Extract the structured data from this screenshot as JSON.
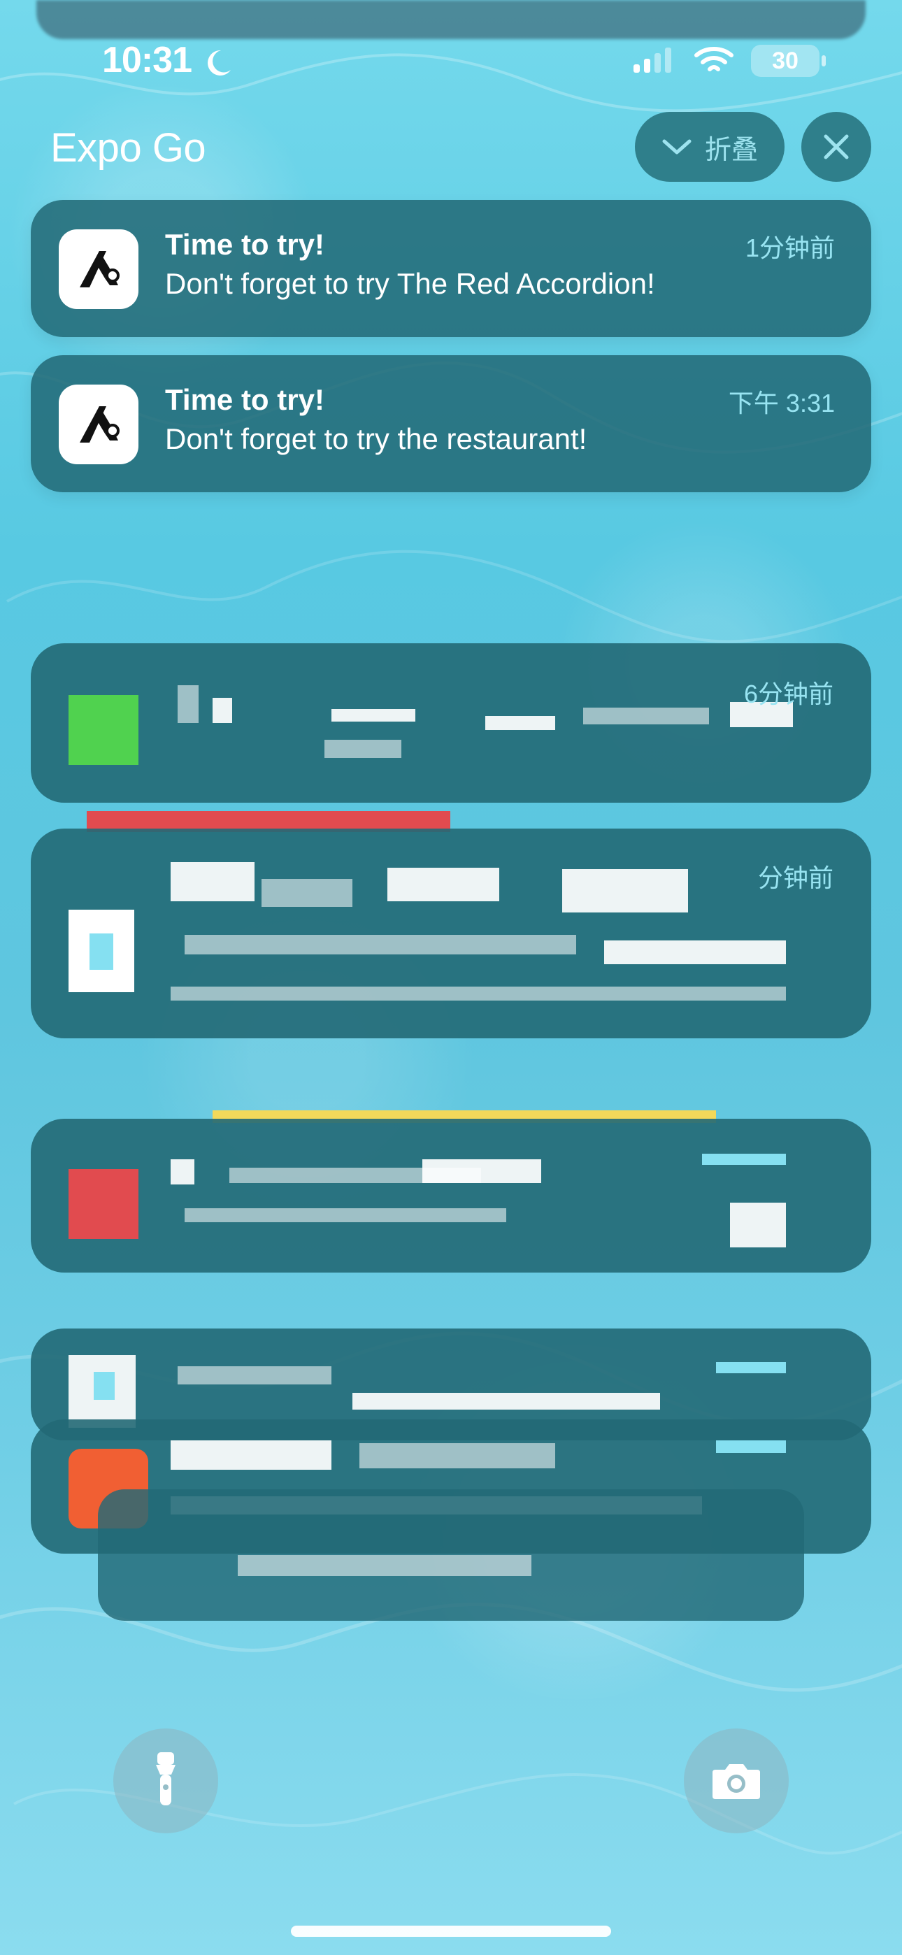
{
  "status_bar": {
    "time": "10:31",
    "battery": "30"
  },
  "group": {
    "title": "Expo Go",
    "fold_label": "折叠"
  },
  "notifications": [
    {
      "title": "Time to try!",
      "body": "Don't forget to try The Red Accordion!",
      "time": "1分钟前"
    },
    {
      "title": "Time to try!",
      "body": "Don't forget to try the restaurant!",
      "time": "下午 3:31"
    }
  ],
  "blurred_notifications": {
    "time_1": "6分钟前",
    "time_2": "分钟前"
  },
  "icons": {
    "moon": "moon-icon",
    "signal": "signal-icon",
    "wifi": "wifi-icon",
    "battery": "battery-icon",
    "chevron": "chevron-down-icon",
    "close": "close-icon",
    "flashlight": "flashlight-icon",
    "camera": "camera-icon"
  },
  "colors": {
    "card_bg": "#226976",
    "accent_text": "#98e4f2",
    "button_bg": "#25707a"
  }
}
